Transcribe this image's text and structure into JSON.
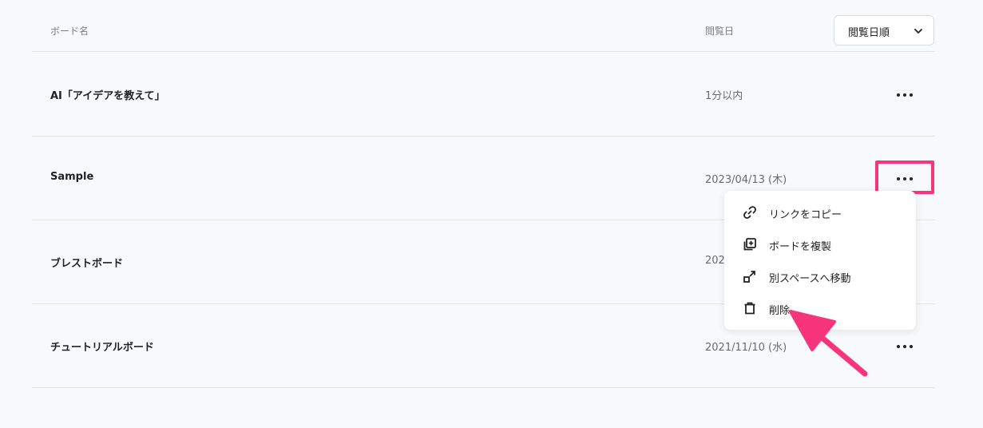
{
  "table": {
    "header_name": "ボード名",
    "header_date": "閲覧日",
    "sort_label": "閲覧日順"
  },
  "rows": [
    {
      "title": "AI「アイデアを教えて」",
      "date": "1分以内"
    },
    {
      "title": "Sample",
      "date": "2023/04/13 (木)"
    },
    {
      "title": "ブレストボード",
      "date": "202"
    },
    {
      "title": "チュートリアルボード",
      "date": "2021/11/10 (水)"
    }
  ],
  "menu": {
    "items": [
      {
        "label": "リンクをコピー",
        "icon": "link-icon"
      },
      {
        "label": "ボードを複製",
        "icon": "duplicate-icon"
      },
      {
        "label": "別スペースへ移動",
        "icon": "move-icon"
      },
      {
        "label": "削除",
        "icon": "trash-icon"
      }
    ]
  },
  "colors": {
    "highlight": "#f7357d",
    "background": "#f8f9fb"
  }
}
